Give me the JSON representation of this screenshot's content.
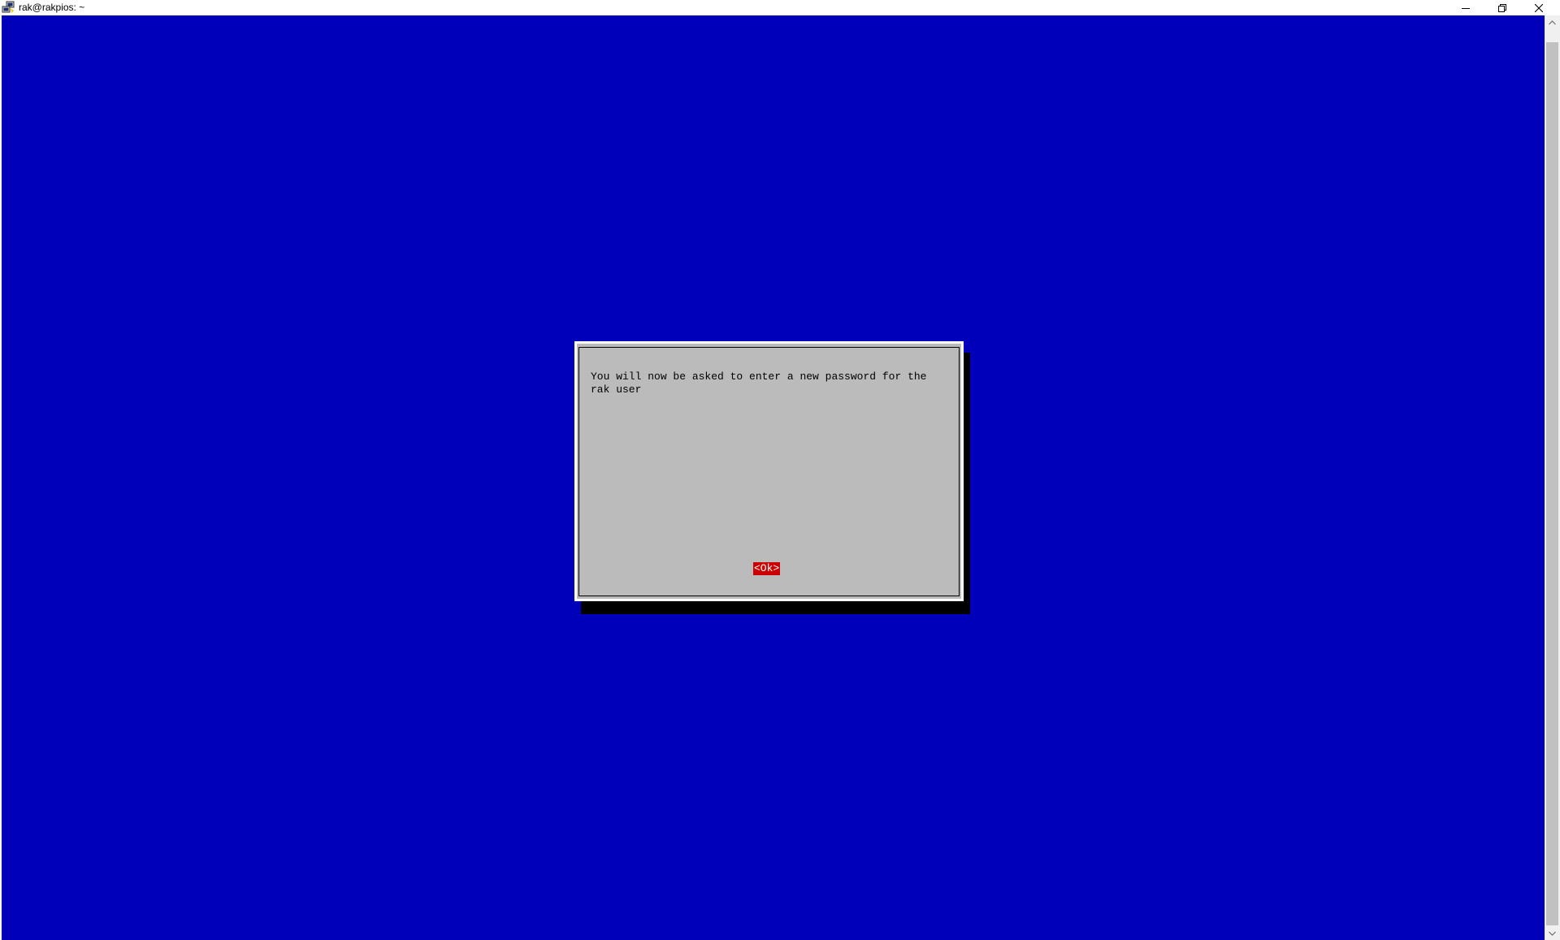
{
  "window": {
    "title": "rak@rakpios: ~",
    "icon": "putty-icon",
    "controls": {
      "minimize": "minimize-icon",
      "maximize": "restore-icon",
      "close": "close-icon"
    }
  },
  "terminal": {
    "background_color": "#0000bb"
  },
  "dialog": {
    "message": "You will now be asked to enter a new password for the\nrak user",
    "ok_label": "<Ok>",
    "background_color": "#bbbbbb",
    "button_color": "#cc0000"
  }
}
